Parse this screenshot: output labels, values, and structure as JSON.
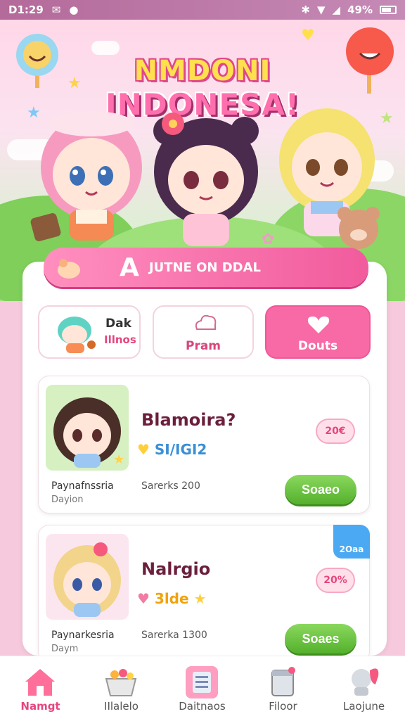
{
  "status_bar": {
    "time": "D1:29",
    "battery": "49%"
  },
  "header": {
    "title_line1": "NMDONI",
    "title_line2": "INDONESA!"
  },
  "banner": {
    "big_letter": "A",
    "text": "JUTNE ON DDAL"
  },
  "tabs": [
    {
      "label_top": "Dak",
      "label_bottom": "Illnos"
    },
    {
      "label": "Pram"
    },
    {
      "label": "Douts"
    }
  ],
  "cards": [
    {
      "name": "Blamoira?",
      "tag": "SI/IGI2",
      "percent": "20€",
      "sub1": "Paynafnssria",
      "sub2": "Dayion",
      "stat": "Sarerks 200",
      "button": "Soaeo"
    },
    {
      "name": "Nalrgio",
      "tag": "3lde",
      "percent": "20%",
      "sub1": "Paynarkesria",
      "sub2": "Daym",
      "stat": "Sarerka 1300",
      "button": "Soaes",
      "badge": "2Oaa"
    }
  ],
  "nav": [
    {
      "label": "Namgt",
      "icon": "home-icon"
    },
    {
      "label": "IIlalelo",
      "icon": "basket-icon"
    },
    {
      "label": "Daitnaos",
      "icon": "list-icon"
    },
    {
      "label": "Filoor",
      "icon": "jar-icon"
    },
    {
      "label": "Laojune",
      "icon": "character-icon"
    }
  ],
  "colors": {
    "accent": "#f15b9d",
    "green": "#54b02c",
    "blue": "#4aa9f2"
  }
}
